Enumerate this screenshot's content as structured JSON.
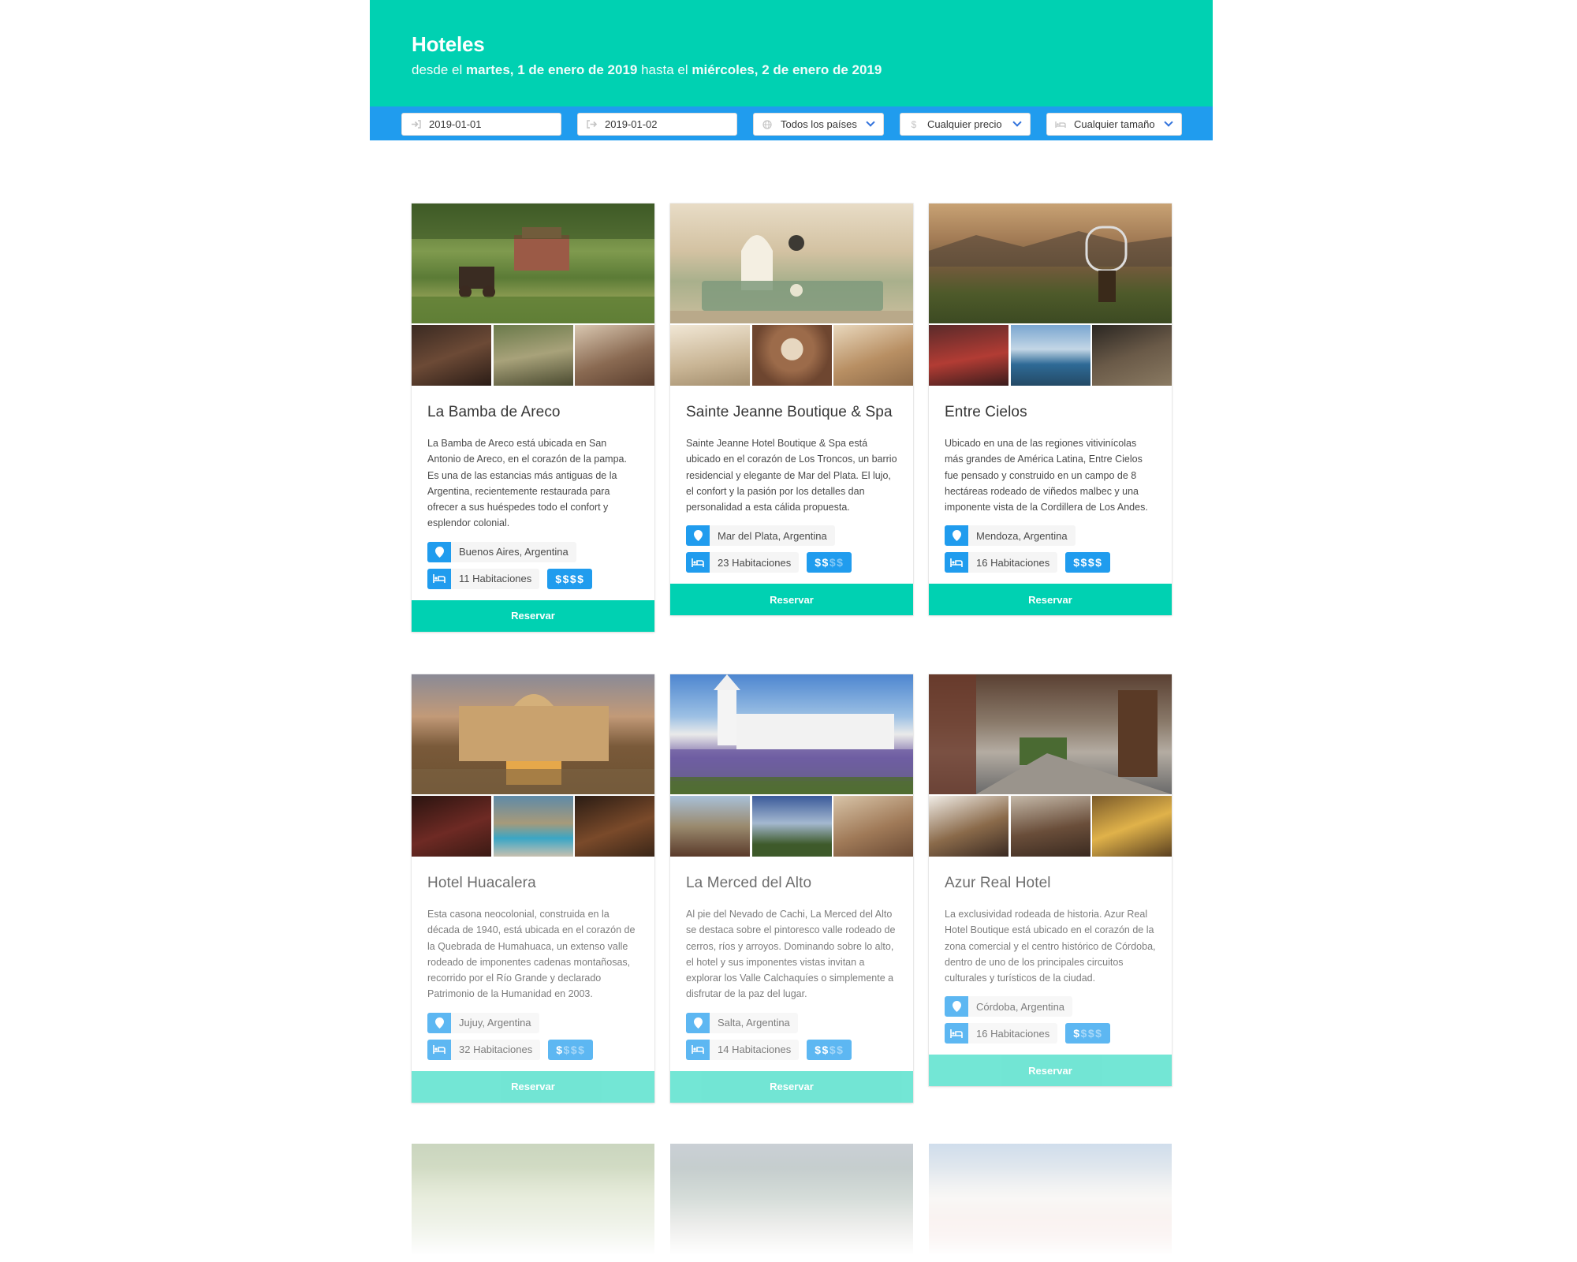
{
  "header": {
    "title": "Hoteles",
    "subtitle_prefix": "desde el",
    "date_from": "martes, 1 de enero de 2019",
    "subtitle_mid": "hasta el",
    "date_to": "miércoles, 2 de enero de 2019"
  },
  "filters": {
    "check_in": "2019-01-01",
    "check_out": "2019-01-02",
    "country": "Todos los países",
    "price": "Cualquier precio",
    "size": "Cualquier tamaño"
  },
  "colors": {
    "primary": "#00d1b2",
    "info": "#209cee",
    "link": "#3273dc"
  },
  "reserve_label": "Reservar",
  "hotels": [
    {
      "name": "La Bamba de Areco",
      "description": "La Bamba de Areco está ubicada en San Antonio de Areco, en el corazón de la pampa. Es una de las estancias más antiguas de la Argentina, recientemente restaurada para ofrecer a sus huéspedes todo el confort y esplendor colonial.",
      "location": "Buenos Aires, Argentina",
      "rooms": "11 Habitaciones",
      "price_level": 4,
      "price_max": 4
    },
    {
      "name": "Sainte Jeanne Boutique & Spa",
      "description": "Sainte Jeanne Hotel Boutique & Spa está ubicado en el corazón de Los Troncos, un barrio residencial y elegante de Mar del Plata. El lujo, el confort y la pasión por los detalles dan personalidad a esta cálida propuesta.",
      "location": "Mar del Plata, Argentina",
      "rooms": "23 Habitaciones",
      "price_level": 2,
      "price_max": 4
    },
    {
      "name": "Entre Cielos",
      "description": "Ubicado en una de las regiones vitivinícolas más grandes de América Latina, Entre Cielos fue pensado y construido en un campo de 8 hectáreas rodeado de viñedos malbec y una imponente vista de la Cordillera de Los Andes.",
      "location": "Mendoza, Argentina",
      "rooms": "16 Habitaciones",
      "price_level": 4,
      "price_max": 4
    },
    {
      "name": "Hotel Huacalera",
      "description": "Esta casona neocolonial, construida en la década de 1940, está ubicada en el corazón de la Quebrada de Humahuaca, un extenso valle rodeado de imponentes cadenas montañosas, recorrido por el Río Grande y declarado Patrimonio de la Humanidad en 2003.",
      "location": "Jujuy, Argentina",
      "rooms": "32 Habitaciones",
      "price_level": 1,
      "price_max": 4
    },
    {
      "name": "La Merced del Alto",
      "description": "Al pie del Nevado de Cachi, La Merced del Alto se destaca sobre el pintoresco valle rodeado de cerros, ríos y arroyos. Dominando sobre lo alto, el hotel y sus imponentes vistas invitan a explorar los Valle Calchaquíes o simplemente a disfrutar de la paz del lugar.",
      "location": "Salta, Argentina",
      "rooms": "14 Habitaciones",
      "price_level": 2,
      "price_max": 4
    },
    {
      "name": "Azur Real Hotel",
      "description": "La exclusividad rodeada de historia. Azur Real Hotel Boutique está ubicado en el corazón de la zona comercial y el centro histórico de Córdoba, dentro de uno de los principales circuitos culturales y turísticos de la ciudad.",
      "location": "Córdoba, Argentina",
      "rooms": "16 Habitaciones",
      "price_level": 1,
      "price_max": 4
    }
  ]
}
